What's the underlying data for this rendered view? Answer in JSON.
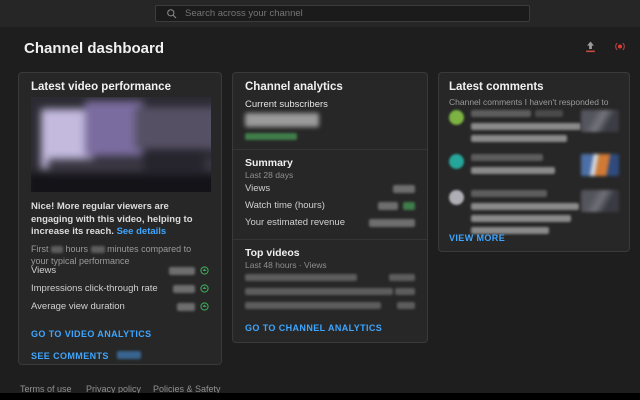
{
  "topbar": {
    "search_placeholder": "Search across your channel"
  },
  "header": {
    "title": "Channel dashboard",
    "icons": [
      {
        "name": "upload-icon"
      },
      {
        "name": "go-live-icon"
      }
    ]
  },
  "latest_video": {
    "title": "Latest video performance",
    "insight_text": "Nice! More regular viewers are engaging with this video, helping to increase its reach.",
    "insight_link": "See details",
    "comparison": {
      "part1": "First",
      "part2": "hours",
      "part3": "minutes compared to your typical performance"
    },
    "metrics": [
      {
        "label": "Views"
      },
      {
        "label": "Impressions click-through rate"
      },
      {
        "label": "Average view duration"
      }
    ],
    "analytics_link": "GO TO VIDEO ANALYTICS",
    "comments_link": "SEE COMMENTS"
  },
  "channel_analytics": {
    "title": "Channel analytics",
    "subscribers_label": "Current subscribers",
    "summary_title": "Summary",
    "summary_subtitle": "Last 28 days",
    "summary_rows": [
      {
        "label": "Views"
      },
      {
        "label": "Watch time (hours)"
      },
      {
        "label": "Your estimated revenue"
      }
    ],
    "top_videos_title": "Top videos",
    "top_videos_subtitle": "Last 48 hours · Views",
    "top_videos_row_count": 3,
    "analytics_link": "GO TO CHANNEL ANALYTICS"
  },
  "latest_comments": {
    "title": "Latest comments",
    "subtitle": "Channel comments I haven't responded to",
    "comment_count_visible": 3,
    "view_more_link": "VIEW MORE"
  },
  "footer": {
    "links": [
      "Terms of use",
      "Privacy policy",
      "Policies & Safety"
    ]
  },
  "colors": {
    "accent_link": "#3ea6ff",
    "positive_green": "#3fa558",
    "brand_red": "#e53935",
    "page_bg": "#1e1e1e",
    "card_bg": "#272727"
  }
}
